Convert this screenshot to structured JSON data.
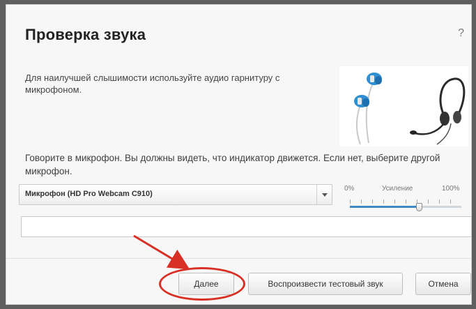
{
  "dialog": {
    "title": "Проверка звука",
    "help_label": "?",
    "intro_text": "Для наилучшей слышимости используйте аудио гарнитуру с микрофоном.",
    "picture_icon": "headset-and-earbuds-icon",
    "instruction_text": "Говорите в микрофон. Вы должны видеть, что индикатор движется. Если нет, выберите другой микрофон.",
    "microphone_select": {
      "selected": "Микрофон (HD Pro Webcam C910)"
    },
    "gain": {
      "min_label": "0%",
      "label": "Усиление",
      "max_label": "100%",
      "value_fraction": 0.62
    },
    "level_meter": {
      "value_fraction": 0
    },
    "buttons": {
      "next": "Далее",
      "play_test": "Воспроизвести тестовый звук",
      "cancel": "Отмена"
    }
  },
  "colors": {
    "accent": "#3a8ac9",
    "annotation": "#d93025",
    "backdrop": "#5f5f5f"
  }
}
